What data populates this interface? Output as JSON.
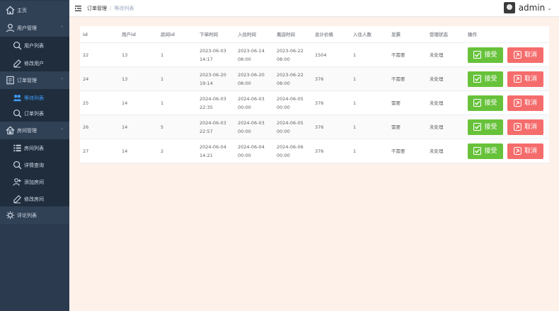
{
  "sidebar": {
    "items": [
      {
        "label": "主页",
        "icon": "home-icon",
        "arrow": ""
      },
      {
        "label": "用户管理",
        "icon": "user-icon",
        "arrow": "⌃"
      },
      {
        "label": "用户列表",
        "icon": "user-search-icon",
        "arrow": ""
      },
      {
        "label": "修改用户",
        "icon": "user-edit-icon",
        "arrow": ""
      },
      {
        "label": "订单管理",
        "icon": "order-icon",
        "arrow": "⌃"
      },
      {
        "label": "等待列表",
        "icon": "wait-list-icon",
        "arrow": ""
      },
      {
        "label": "订单列表",
        "icon": "order-search-icon",
        "arrow": ""
      },
      {
        "label": "房间管理",
        "icon": "house-icon",
        "arrow": "⌃"
      },
      {
        "label": "房间列表",
        "icon": "list-icon",
        "arrow": ""
      },
      {
        "label": "详情查询",
        "icon": "detail-search-icon",
        "arrow": ""
      },
      {
        "label": "添加房间",
        "icon": "add-room-icon",
        "arrow": ""
      },
      {
        "label": "修改房间",
        "icon": "edit-room-icon",
        "arrow": ""
      },
      {
        "label": "评论列表",
        "icon": "comment-icon",
        "arrow": ""
      }
    ]
  },
  "header": {
    "breadcrumb": [
      "订单管理",
      "等待列表"
    ],
    "separator": "/",
    "username": "admin",
    "caret": "⌄"
  },
  "table": {
    "columns": [
      "id",
      "用户id",
      "房间id",
      "下单时间",
      "入住时间",
      "离店时间",
      "总计价格",
      "入住人数",
      "发票",
      "受理状态",
      "操作"
    ],
    "rows": [
      [
        "22",
        "13",
        "1",
        "2023-06-03 14:17",
        "2023-06-14 08:00",
        "2023-06-22 08:00",
        "1504",
        "1",
        "不需要",
        "未处理"
      ],
      [
        "24",
        "13",
        "1",
        "2023-06-20 19:14",
        "2023-06-20 08:00",
        "2023-06-22 08:00",
        "376",
        "1",
        "不需要",
        "未处理"
      ],
      [
        "25",
        "14",
        "1",
        "2024-06-03 22:35",
        "2024-06-03 00:00",
        "2024-06-05 00:00",
        "376",
        "1",
        "需要",
        "未处理"
      ],
      [
        "26",
        "14",
        "5",
        "2024-06-03 22:57",
        "2024-06-03 00:00",
        "2024-06-05 00:00",
        "376",
        "1",
        "需要",
        "未处理"
      ],
      [
        "27",
        "14",
        "2",
        "2024-06-04 14:21",
        "2024-06-04 00:00",
        "2024-06-06 00:00",
        "376",
        "1",
        "不需要",
        "未处理"
      ]
    ],
    "accept_label": "接受",
    "cancel_label": "取消"
  },
  "colors": {
    "sidebar_bg": "#2b3a4e",
    "active_menu": "#409eff",
    "accept": "#67c23a",
    "cancel": "#f56c6c",
    "page_bg": "#fdf1ea"
  }
}
